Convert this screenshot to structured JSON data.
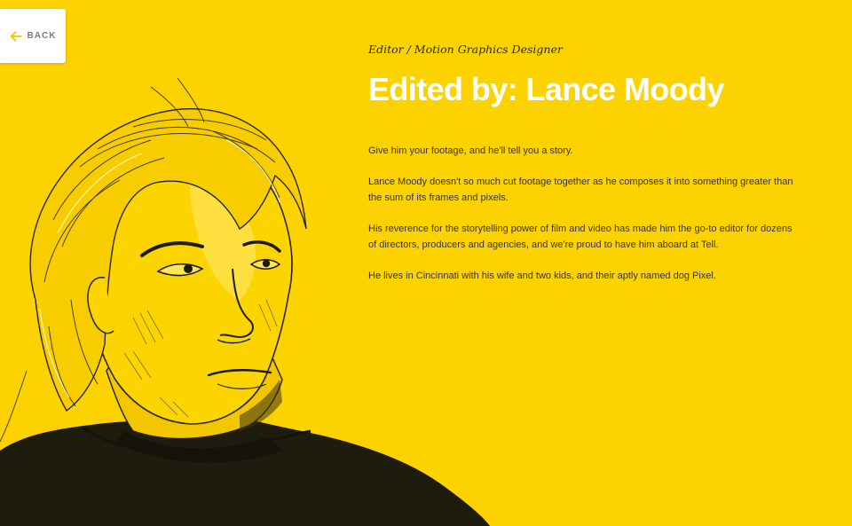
{
  "nav": {
    "back_label": "BACK",
    "back_icon": "arrow-left-icon",
    "accent": "#f5c400"
  },
  "profile": {
    "role": "Editor / Motion Graphics Designer",
    "title": "Edited by: Lance Moody",
    "bio": [
      "Give him your footage, and he'll tell you a story.",
      "Lance Moody doesn't so much cut footage together as he composes it into something greater than the sum of its frames and pixels.",
      "His reverence for the storytelling power of film and video has made him the go-to editor for dozens of directors, producers and agencies, and we're proud to have him aboard at Tell.",
      "He lives in Cincinnati with his wife and two kids, and their aptly named dog Pixel."
    ]
  },
  "theme": {
    "background": "#fcd200",
    "title_color": "#ffffff",
    "text_color": "#3a3318"
  }
}
